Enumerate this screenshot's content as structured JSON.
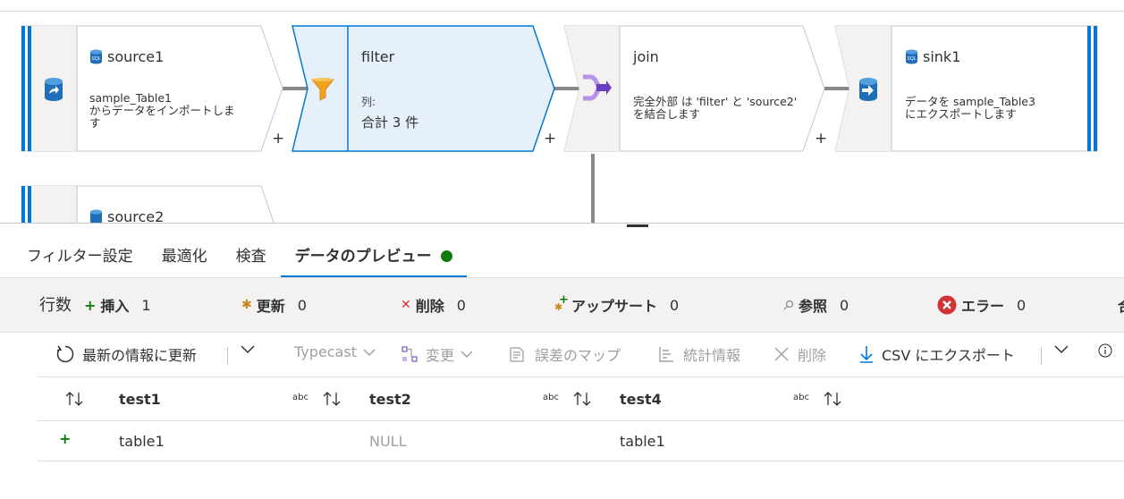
{
  "canvas": {
    "nodes": {
      "source1": {
        "title": "source1",
        "desc_line1": "sample_Table1",
        "desc_line2": "からデータをインポートしま",
        "desc_line3": "す"
      },
      "filter": {
        "title": "filter",
        "desc_label": "列:",
        "count": "合計 3 件"
      },
      "join": {
        "title": "join",
        "desc_line1": "完全外部 は 'filter' と 'source2'",
        "desc_line2": "を結合します"
      },
      "sink1": {
        "title": "sink1",
        "desc_line1": "データを sample_Table3",
        "desc_line2": "にエクスポートします"
      },
      "source2": {
        "title": "source2"
      }
    },
    "plus_symbol": "+",
    "colors": {
      "accent": "#0078d4",
      "filter_fill": "#e6f0fb",
      "connector": "#8a8886",
      "node_gray": "#f3f2f1"
    }
  },
  "tabs": [
    {
      "label": "フィルター設定"
    },
    {
      "label": "最適化"
    },
    {
      "label": "検査"
    },
    {
      "label": "データのプレビュー"
    }
  ],
  "stats": {
    "rows_label": "行数",
    "insert": {
      "label": "挿入",
      "value": "1"
    },
    "update": {
      "label": "更新",
      "value": "0"
    },
    "delete": {
      "label": "削除",
      "value": "0"
    },
    "upsert": {
      "label": "アップサート",
      "value": "0"
    },
    "lookup": {
      "label": "参照",
      "value": "0"
    },
    "error": {
      "label": "エラー",
      "value": "0"
    },
    "cutoff": {
      "label": "合"
    }
  },
  "toolbar": {
    "refresh": "最新の情報に更新",
    "typecast": "Typecast",
    "modify": "変更",
    "error_map": "誤差のマップ",
    "statistics": "統計情報",
    "remove": "削除",
    "export_csv": "CSV にエクスポート"
  },
  "grid": {
    "type_tag": "abc",
    "columns": [
      "test1",
      "test2",
      "test4"
    ],
    "rows": [
      {
        "marker": "+",
        "cells": [
          "table1",
          "NULL",
          "table1"
        ]
      }
    ]
  }
}
